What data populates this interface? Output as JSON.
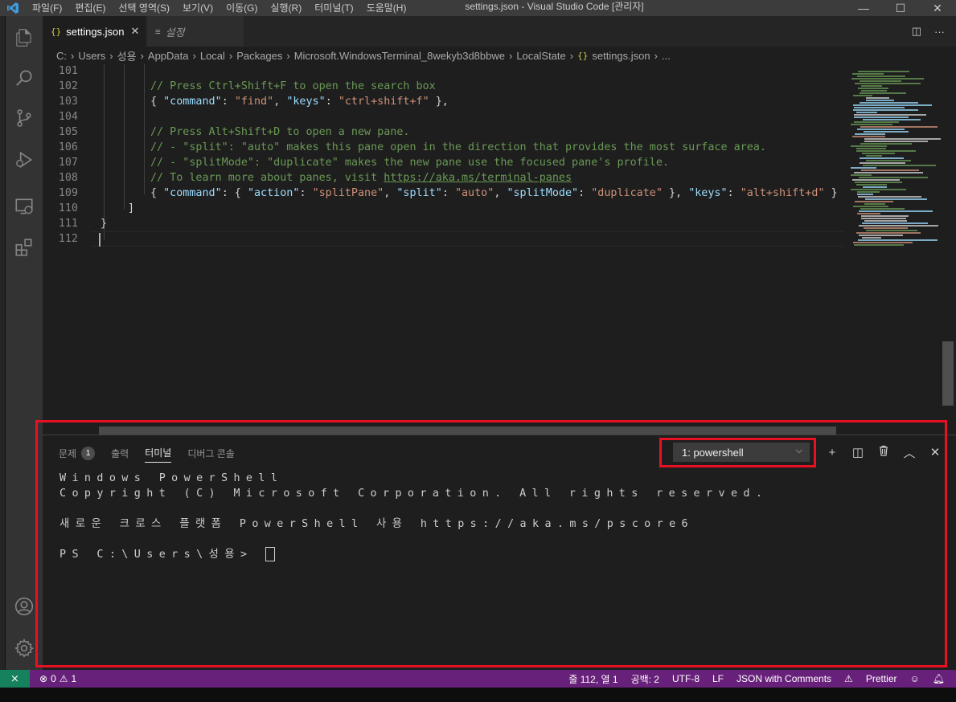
{
  "window": {
    "title": "settings.json - Visual Studio Code [관리자]",
    "menu": [
      "파일(F)",
      "편집(E)",
      "선택 영역(S)",
      "보기(V)",
      "이동(G)",
      "실행(R)",
      "터미널(T)",
      "도움말(H)"
    ],
    "controls": {
      "minimize": "—",
      "maximize": "☐",
      "close": "✕"
    }
  },
  "activity_bar": {
    "icons": [
      "files-icon",
      "search-icon",
      "source-control-icon",
      "run-debug-icon",
      "remote-explorer-icon",
      "extensions-icon",
      "account-icon",
      "settings-gear-icon"
    ]
  },
  "tabs": {
    "active": {
      "icon": "{}",
      "label": "settings.json",
      "close": "✕"
    },
    "inactive": {
      "icon": "≡",
      "label": "설정"
    },
    "actions": {
      "split": "◫",
      "more": "···"
    }
  },
  "breadcrumb": {
    "parts": [
      "C:",
      "Users",
      "성용",
      "AppData",
      "Local",
      "Packages",
      "Microsoft.WindowsTerminal_8wekyb3d8bbwe",
      "LocalState"
    ],
    "file_icon": "{}",
    "file": "settings.json",
    "tail": "..."
  },
  "editor": {
    "lines": [
      {
        "n": "101",
        "segments": []
      },
      {
        "n": "102",
        "segments": [
          {
            "c": "com",
            "t": "// Press Ctrl+Shift+F to open the search box"
          }
        ]
      },
      {
        "n": "103",
        "segments": [
          {
            "c": "",
            "t": "{ "
          },
          {
            "c": "key",
            "t": "\"command\""
          },
          {
            "c": "",
            "t": ": "
          },
          {
            "c": "str",
            "t": "\"find\""
          },
          {
            "c": "",
            "t": ", "
          },
          {
            "c": "key",
            "t": "\"keys\""
          },
          {
            "c": "",
            "t": ": "
          },
          {
            "c": "str",
            "t": "\"ctrl+shift+f\""
          },
          {
            "c": "",
            "t": " },"
          }
        ]
      },
      {
        "n": "104",
        "segments": []
      },
      {
        "n": "105",
        "segments": [
          {
            "c": "com",
            "t": "// Press Alt+Shift+D to open a new pane."
          }
        ]
      },
      {
        "n": "106",
        "segments": [
          {
            "c": "com",
            "t": "// - \"split\": \"auto\" makes this pane open in the direction that provides the most surface area."
          }
        ]
      },
      {
        "n": "107",
        "segments": [
          {
            "c": "com",
            "t": "// - \"splitMode\": \"duplicate\" makes the new pane use the focused pane's profile."
          }
        ]
      },
      {
        "n": "108",
        "segments": [
          {
            "c": "com",
            "t": "// To learn more about panes, visit "
          },
          {
            "c": "link",
            "t": "https://aka.ms/terminal-panes"
          }
        ]
      },
      {
        "n": "109",
        "segments": [
          {
            "c": "",
            "t": "{ "
          },
          {
            "c": "key",
            "t": "\"command\""
          },
          {
            "c": "",
            "t": ": { "
          },
          {
            "c": "key",
            "t": "\"action\""
          },
          {
            "c": "",
            "t": ": "
          },
          {
            "c": "str",
            "t": "\"splitPane\""
          },
          {
            "c": "",
            "t": ", "
          },
          {
            "c": "key",
            "t": "\"split\""
          },
          {
            "c": "",
            "t": ": "
          },
          {
            "c": "str",
            "t": "\"auto\""
          },
          {
            "c": "",
            "t": ", "
          },
          {
            "c": "key",
            "t": "\"splitMode\""
          },
          {
            "c": "",
            "t": ": "
          },
          {
            "c": "str",
            "t": "\"duplicate\""
          },
          {
            "c": "",
            "t": " }, "
          },
          {
            "c": "key",
            "t": "\"keys\""
          },
          {
            "c": "",
            "t": ": "
          },
          {
            "c": "str",
            "t": "\"alt+shift+d\""
          },
          {
            "c": "",
            "t": " }"
          }
        ]
      },
      {
        "n": "110",
        "segments": [
          {
            "c": "",
            "t": "]"
          }
        ]
      },
      {
        "n": "111",
        "segments": [
          {
            "c": "",
            "t": "}"
          }
        ]
      },
      {
        "n": "112",
        "segments": []
      }
    ]
  },
  "panel": {
    "tabs": [
      {
        "label": "문제",
        "badge": "1"
      },
      {
        "label": "출력"
      },
      {
        "label": "터미널",
        "active": true
      },
      {
        "label": "디버그 콘솔"
      }
    ],
    "terminal_select": "1: powershell",
    "actions": {
      "new": "+",
      "split": "◫",
      "kill": "🗑",
      "maximize": "︿",
      "close": "✕"
    },
    "terminal_lines": [
      "Windows PowerShell",
      "Copyright (C) Microsoft Corporation. All rights reserved.",
      "",
      "새로운 크로스 플랫폼 PowerShell 사용 https://aka.ms/pscore6",
      "",
      "PS C:\\Users\\성용> "
    ]
  },
  "status_bar": {
    "remote_icon": "remote-icon",
    "errors": "0",
    "warnings": "1",
    "position": "줄 112, 열 1",
    "spaces": "공백: 2",
    "encoding": "UTF-8",
    "eol": "LF",
    "language": "JSON with Comments",
    "prettier": "Prettier",
    "colors": {
      "background": "#68217a",
      "remote": "#16825d"
    }
  }
}
